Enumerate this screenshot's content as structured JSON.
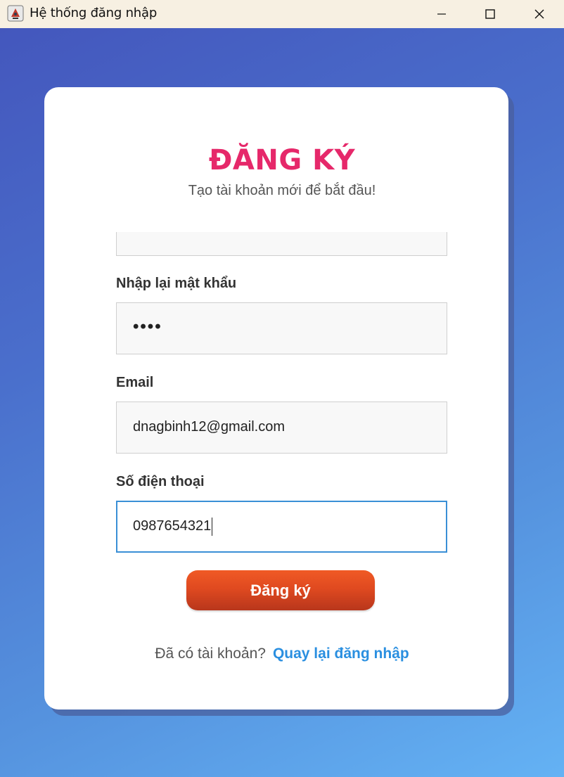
{
  "window": {
    "title": "Hệ thống đăng nhập",
    "icons": [
      "java-app-icon",
      "minimize-icon",
      "maximize-icon",
      "close-icon"
    ]
  },
  "form": {
    "heading": "ĐĂNG KÝ",
    "subtitle": "Tạo tài khoản mới để bắt đầu!",
    "password_masked": "••••",
    "confirm_password_label": "Nhập lại mật khẩu",
    "confirm_password_masked": "••••",
    "email_label": "Email",
    "email_value": "dnagbinh12@gmail.com",
    "phone_label": "Số điện thoại",
    "phone_value": "0987654321",
    "submit_label": "Đăng ký",
    "footer_question": "Đã có tài khoản?",
    "footer_link": "Quay lại đăng nhập"
  },
  "colors": {
    "heading": "#e6286a",
    "link": "#2a8fe0",
    "button": "#e04a20",
    "focus_border": "#3a8fd6",
    "background_start": "#4457bd",
    "background_end": "#64b2f4"
  }
}
